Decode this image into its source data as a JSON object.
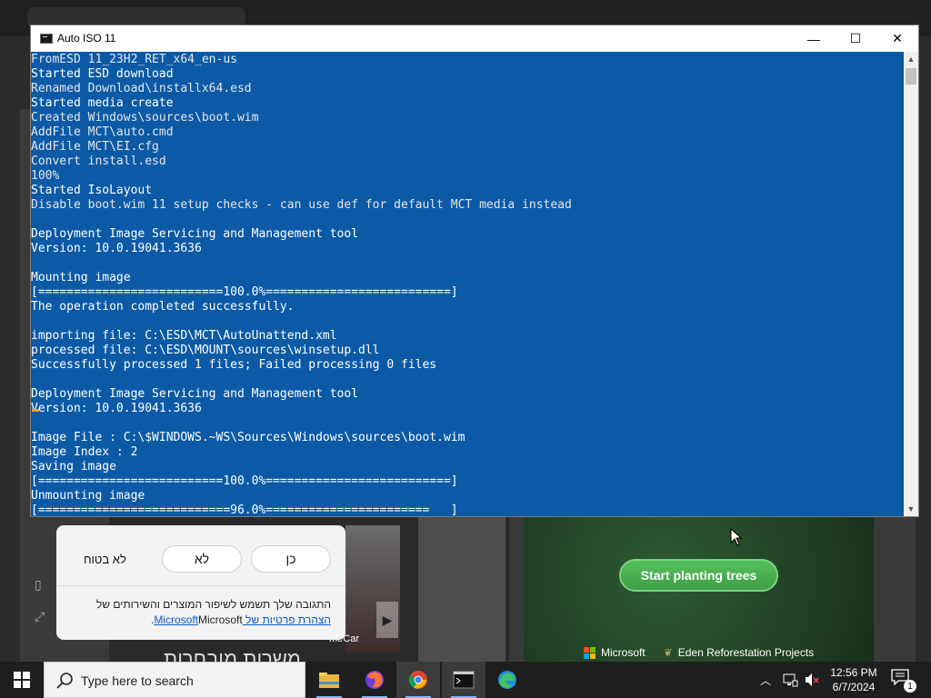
{
  "console": {
    "title": "Auto ISO 11",
    "controls": {
      "minimize": "—",
      "maximize": "☐",
      "close": "✕"
    },
    "lines": [
      {
        "text": "FromESD 11_23H2_RET_x64_en-us",
        "hi": false
      },
      {
        "text": "Started ESD download",
        "hi": true
      },
      {
        "text": "Renamed Download\\installx64.esd",
        "hi": false
      },
      {
        "text": "Started media create",
        "hi": true
      },
      {
        "text": "Created Windows\\sources\\boot.wim",
        "hi": false
      },
      {
        "text": "AddFile MCT\\auto.cmd",
        "hi": false
      },
      {
        "text": "AddFile MCT\\EI.cfg",
        "hi": false
      },
      {
        "text": "Convert install.esd",
        "hi": false
      },
      {
        "text": "100%",
        "hi": false
      },
      {
        "text": "Started IsoLayout",
        "hi": true
      },
      {
        "text": "Disable boot.wim 11 setup checks - can use def for default MCT media instead",
        "hi": false
      },
      {
        "text": "",
        "hi": false
      },
      {
        "text": "Deployment Image Servicing and Management tool",
        "hi": true
      },
      {
        "text": "Version: 10.0.19041.3636",
        "hi": true
      },
      {
        "text": "",
        "hi": false
      },
      {
        "text": "Mounting image",
        "hi": true
      },
      {
        "text": "[==========================100.0%==========================]",
        "hi": true
      },
      {
        "text": "The operation completed successfully.",
        "hi": true
      },
      {
        "text": "",
        "hi": false
      },
      {
        "text": "importing file: C:\\ESD\\MCT\\AutoUnattend.xml",
        "hi": true
      },
      {
        "text": "processed file: C:\\ESD\\MOUNT\\sources\\winsetup.dll",
        "hi": true
      },
      {
        "text": "Successfully processed 1 files; Failed processing 0 files",
        "hi": true
      },
      {
        "text": "",
        "hi": false
      },
      {
        "text": "Deployment Image Servicing and Management tool",
        "hi": true
      },
      {
        "text": "Version: 10.0.19041.3636",
        "hi": true
      },
      {
        "text": "",
        "hi": false
      },
      {
        "text": "Image File : C:\\$WINDOWS.~WS\\Sources\\Windows\\sources\\boot.wim",
        "hi": true
      },
      {
        "text": "Image Index : 2",
        "hi": true
      },
      {
        "text": "Saving image",
        "hi": true
      },
      {
        "text": "[==========================100.0%==========================]",
        "hi": true
      },
      {
        "text": "Unmounting image",
        "hi": true
      },
      {
        "text": "[===========================96.0%=======================   ]",
        "hi": true
      }
    ]
  },
  "feedback": {
    "yes": "כן",
    "no": "לא",
    "not_sure": "לא בטוח",
    "text1": "התגובה שלך תשמש לשיפור המוצרים והשירותים של",
    "text2_prefix": "Microsoft.",
    "text2_link": "הצהרת פרטיות של Microsoft"
  },
  "background": {
    "plant_button": "Start planting trees",
    "microsoft": "Microsoft",
    "eden": "Eden Reforestation Projects",
    "mecar": "meCar",
    "hebrew_bottom": "משרות מובחרות"
  },
  "taskbar": {
    "search_placeholder": "Type here to search",
    "time": "12:56 PM",
    "date": "6/7/2024",
    "notification_count": "1",
    "apps": [
      "file-explorer-icon",
      "firefox-icon",
      "chrome-icon",
      "terminal-icon",
      "edge-icon"
    ]
  },
  "colors": {
    "console_bg": "#0c5aa6",
    "plant_green": "#4caf50",
    "taskbar": "#1e1e1e"
  }
}
